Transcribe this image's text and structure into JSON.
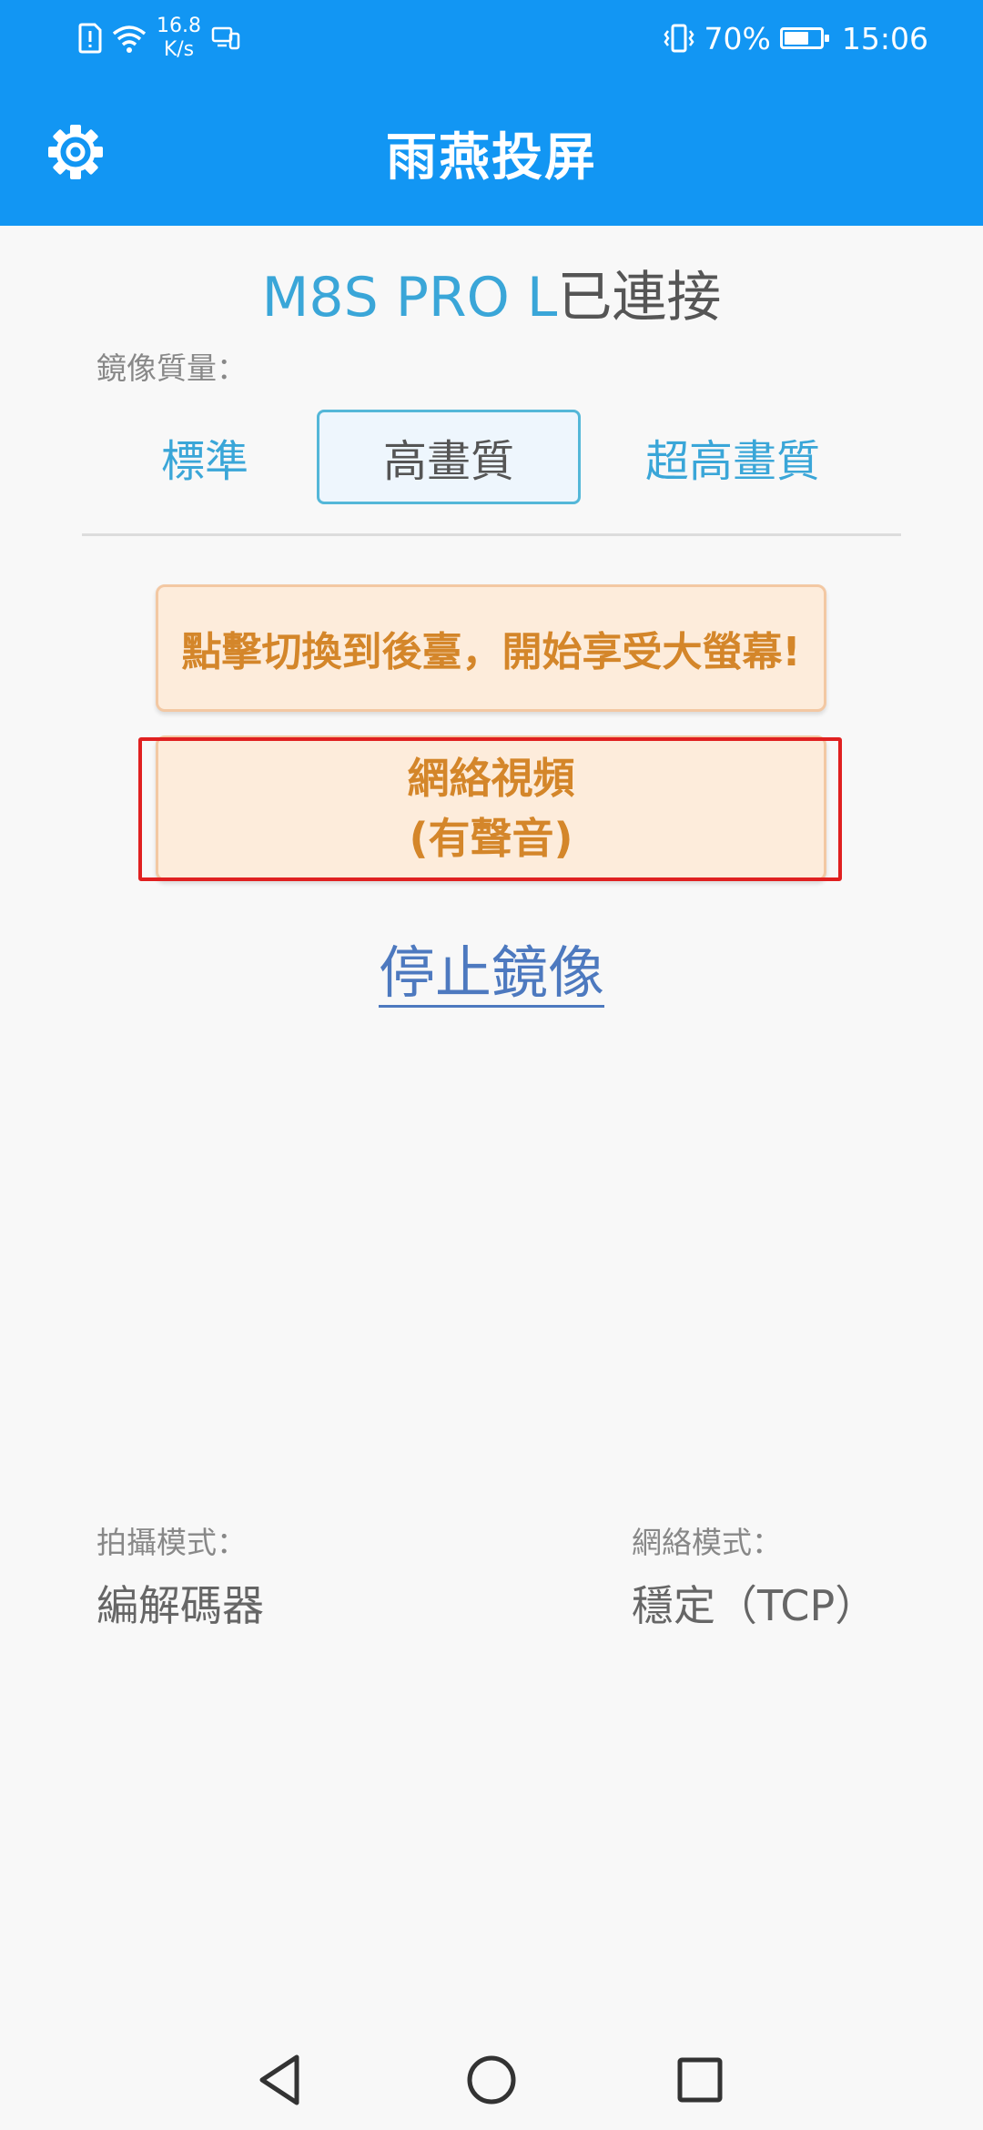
{
  "status_bar": {
    "net_speed_value": "16.8",
    "net_speed_unit": "K/s",
    "battery_percent": "70%",
    "battery_level": 0.7,
    "time": "15:06",
    "icons": [
      "sim-alert-icon",
      "wifi-icon",
      "cast-icon",
      "vibrate-icon",
      "battery-icon"
    ]
  },
  "app_bar": {
    "title": "雨燕投屏",
    "settings_icon": "gear-icon"
  },
  "connection": {
    "device_name": "M8S PRO L",
    "status": "已連接"
  },
  "quality": {
    "label": "鏡像質量：",
    "options": [
      "標準",
      "高畫質",
      "超高畫質"
    ],
    "selected": "高畫質"
  },
  "actions": {
    "background_button": "點擊切換到後臺，開始享受大螢幕!",
    "network_video_line1": "網絡視頻",
    "network_video_line2": "(有聲音)",
    "stop_mirroring": "停止鏡像"
  },
  "info": {
    "capture_mode_label": "拍攝模式：",
    "capture_mode_value": "編解碼器",
    "network_mode_label": "網絡模式：",
    "network_mode_value": "穩定（TCP）"
  },
  "colors": {
    "app_bar": "#1296f3",
    "accent_text": "#3aa6d8",
    "orange_text": "#d4862a",
    "orange_bg": "#fdecdb",
    "highlight_border": "#e02020",
    "link": "#4d79bf"
  },
  "nav_bar": {
    "icons": [
      "back-icon",
      "home-icon",
      "recents-icon"
    ]
  }
}
